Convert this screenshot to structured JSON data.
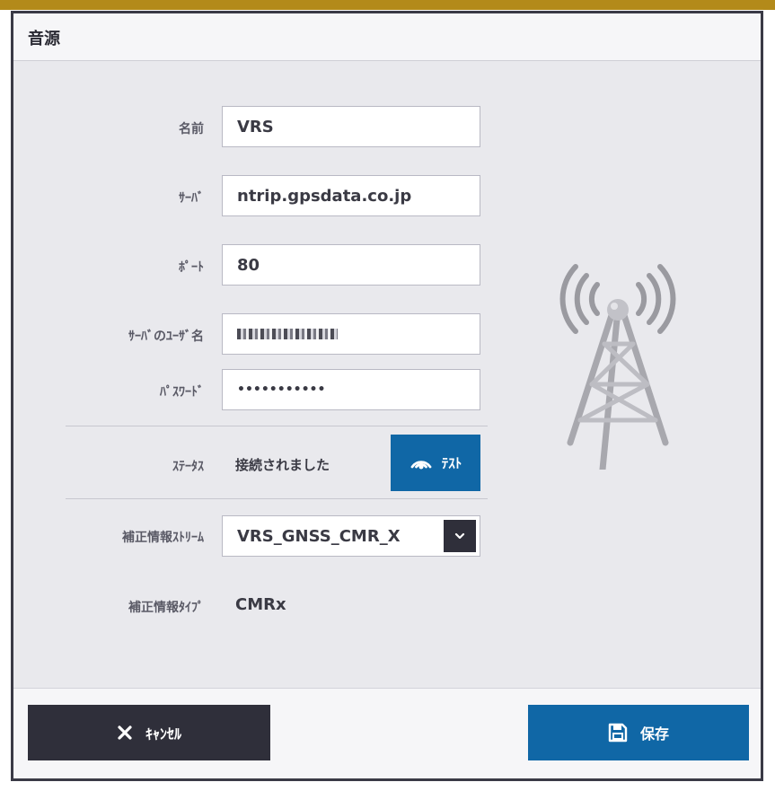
{
  "dialog": {
    "title": "音源"
  },
  "form": {
    "name": {
      "label": "名前",
      "value": "VRS"
    },
    "server": {
      "label": "ｻｰﾊﾞ",
      "value": "ntrip.gpsdata.co.jp"
    },
    "port": {
      "label": "ﾎﾟｰﾄ",
      "value": "80"
    },
    "username": {
      "label": "ｻｰﾊﾞのﾕｰｻﾞ名",
      "value": ""
    },
    "password": {
      "label": "ﾊﾟｽﾜｰﾄﾞ",
      "value": "•••••••••••"
    },
    "status": {
      "label": "ｽﾃｰﾀｽ",
      "value": "接続されました"
    },
    "test_button": "ﾃｽﾄ",
    "stream": {
      "label": "補正情報ｽﾄﾘｰﾑ",
      "value": "VRS_GNSS_CMR_X"
    },
    "type": {
      "label": "補正情報ﾀｲﾌﾟ",
      "value": "CMRx"
    }
  },
  "footer": {
    "cancel_label": "ｷｬﾝｾﾙ",
    "save_label": "保存"
  },
  "colors": {
    "primary": "#1067a6",
    "dark": "#2f2f3a",
    "accent_bar": "#b38a1a"
  },
  "icons": [
    "wifi-signal-icon",
    "chevron-down-icon",
    "close-icon",
    "save-disk-icon",
    "radio-tower-icon"
  ]
}
